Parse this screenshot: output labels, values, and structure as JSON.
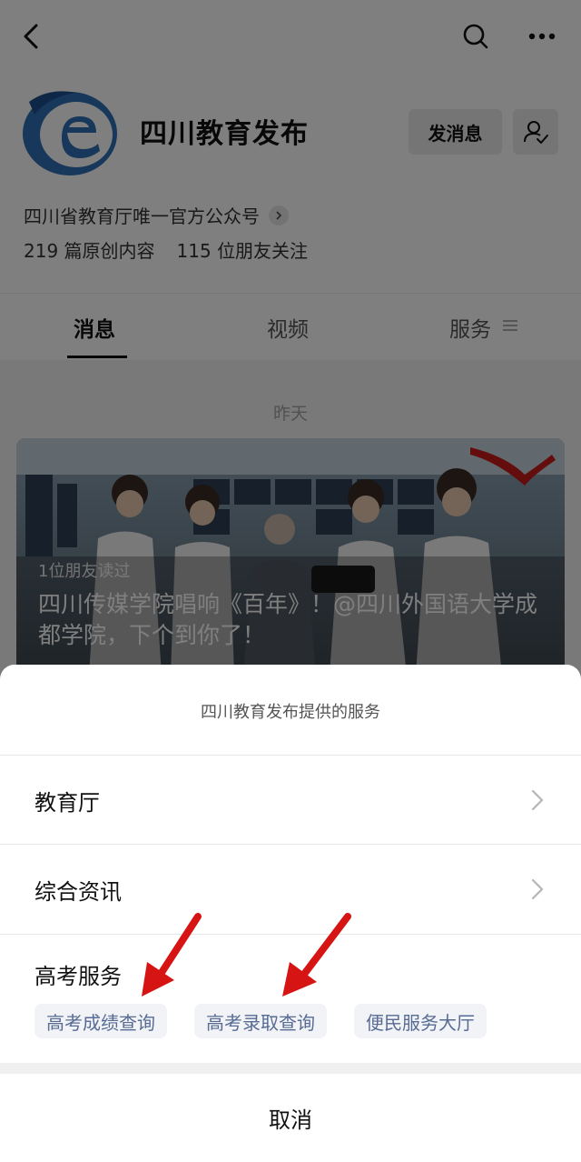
{
  "account": {
    "name": "四川教育发布",
    "description": "四川省教育厅唯一官方公众号",
    "stats_original": "219 篇原创内容",
    "stats_followers": "115 位朋友关注",
    "message_button": "发消息"
  },
  "tabs": [
    {
      "label": "消息",
      "active": true
    },
    {
      "label": "视频",
      "active": false
    },
    {
      "label": "服务",
      "active": false
    }
  ],
  "feed": {
    "date_label": "昨天",
    "article": {
      "read_count": "1位朋友读过",
      "title": "四川传媒学院唱响《百年》！@四川外国语大学成都学院，下个到你了！"
    }
  },
  "sheet": {
    "title": "四川教育发布提供的服务",
    "rows": [
      {
        "label": "教育厅"
      },
      {
        "label": "综合资讯"
      }
    ],
    "gaokao": {
      "title": "高考服务",
      "chips": [
        "高考成绩查询",
        "高考录取查询",
        "便民服务大厅"
      ]
    },
    "cancel": "取消"
  },
  "colors": {
    "overlay": "#00000080",
    "chip_text": "#576b95",
    "chip_bg": "#f1f3f6",
    "annotation_arrow": "#d71414"
  },
  "icons": [
    "back-icon",
    "search-icon",
    "more-icon",
    "follow-icon",
    "chevron-right-icon",
    "tab-menu-icon"
  ]
}
